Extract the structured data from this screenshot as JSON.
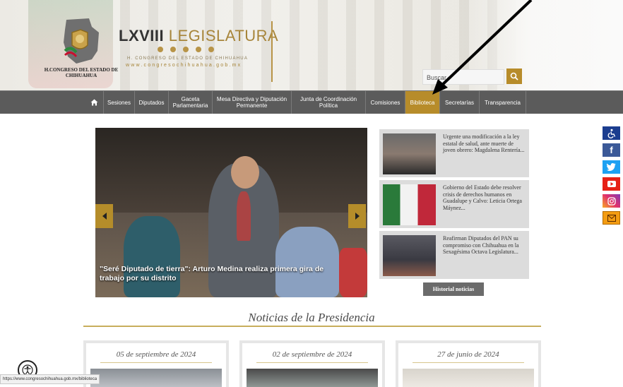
{
  "header": {
    "congreso_name": "H.CONGRESO DEL ESTADO DE CHIHUAHUA",
    "legislatura_bold": "LXVIII",
    "legislatura_light": "LEGISLATURA",
    "subtitle": "H. CONGRESO DEL ESTADO DE CHIHUAHUA",
    "url": "www.congresochihuahua.gob.mx",
    "search_placeholder": "Buscar"
  },
  "nav": {
    "items": [
      {
        "label": "Sesiones"
      },
      {
        "label": "Diputados"
      },
      {
        "label": "Gaceta Parlamentaria"
      },
      {
        "label": "Mesa Directiva y Diputación Permanente"
      },
      {
        "label": "Junta de Coordinación Política"
      },
      {
        "label": "Comisiones"
      },
      {
        "label": "Biblioteca"
      },
      {
        "label": "Secretarías"
      },
      {
        "label": "Transparencia"
      }
    ]
  },
  "slider": {
    "caption": "\"Seré Diputado de tierra\": Arturo Medina realiza primera gira de trabajo por su distrito"
  },
  "news": [
    {
      "title": "Urgente una modificación a la ley estatal de salud, ante muerte de joven obrero: Magdalena Rentería..."
    },
    {
      "title": "Gobierno del Estado debe resolver crisis de derechos humanos en Guadalupe y Calvo: Leticia Ortega Máynez..."
    },
    {
      "title": "Reafirman Diputados del PAN su compromiso con Chihuahua en la Sexagésima Octava Legislatura..."
    }
  ],
  "history_button": "Historial noticias",
  "presidencia": {
    "title": "Noticias de la Presidencia",
    "dates": [
      "05 de septiembre de 2024",
      "02 de septiembre de 2024",
      "27 de junio de 2024"
    ]
  },
  "status_url": "https://www.congresochihuahua.gob.mx/biblioteca",
  "colors": {
    "accent": "#b78c2a",
    "nav_bg": "#5b5b5b"
  }
}
